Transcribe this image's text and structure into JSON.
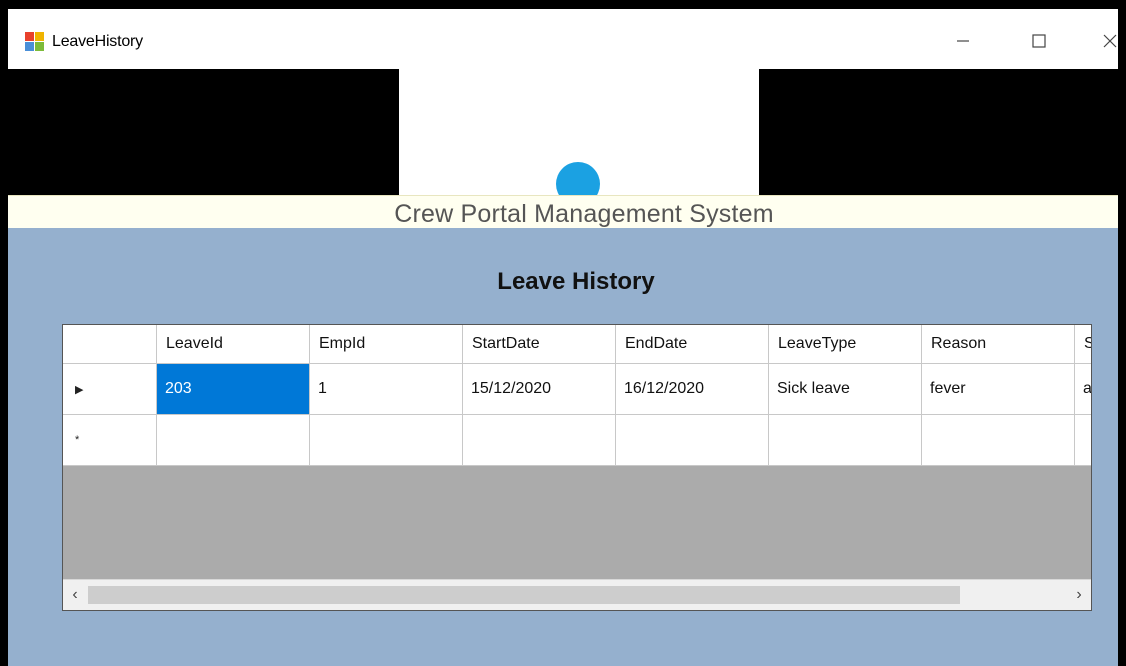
{
  "window": {
    "title": "LeaveHistory",
    "controls": {
      "minimize": "—",
      "maximize": "☐",
      "close": "✕"
    }
  },
  "header": {
    "system_name": "Crew Portal Management System"
  },
  "page": {
    "heading": "Leave History"
  },
  "grid": {
    "columns": [
      "LeaveId",
      "EmpId",
      "StartDate",
      "EndDate",
      "LeaveType",
      "Reason",
      "St"
    ],
    "rows": [
      {
        "indicator": "▶",
        "cells": [
          "203",
          "1",
          "15/12/2020",
          "16/12/2020",
          "Sick leave",
          "fever",
          "app"
        ]
      },
      {
        "indicator": "*",
        "cells": [
          "",
          "",
          "",
          "",
          "",
          "",
          ""
        ]
      }
    ],
    "selected_cell": "rows.0.cells.0",
    "scroll_left": "‹",
    "scroll_right": "›"
  },
  "colors": {
    "banner": "#000000",
    "content_bg": "#95b0ce",
    "system_bar": "#fffff0",
    "selection": "#0078d7",
    "logo_accent": "#1ba1e2"
  }
}
